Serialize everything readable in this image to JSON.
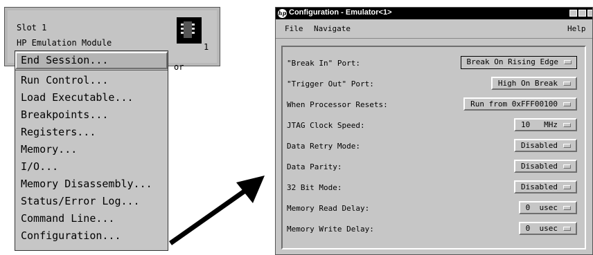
{
  "module_panel": {
    "slot": "Slot 1",
    "name": "HP Emulation Module",
    "chip_number": "1",
    "hidden_tail": "or"
  },
  "popup_menu": {
    "items": [
      "End Session...",
      "Run Control...",
      "Load Executable...",
      "Breakpoints...",
      "Registers...",
      "Memory...",
      "I/O...",
      "Memory Disassembly...",
      "Status/Error Log...",
      "Command Line...",
      "Configuration..."
    ]
  },
  "config_window": {
    "title": "Configuration - Emulator<1>",
    "menu": {
      "file": "File",
      "navigate": "Navigate",
      "help": "Help"
    },
    "settings": [
      {
        "label": "\"Break In\" Port:",
        "value": "Break On Rising Edge"
      },
      {
        "label": "\"Trigger Out\" Port:",
        "value": "High On Break"
      },
      {
        "label": "When Processor Resets:",
        "value": "Run from 0xFFF00100"
      },
      {
        "label": "JTAG Clock Speed:",
        "value": "10   MHz"
      },
      {
        "label": "Data Retry Mode:",
        "value": "Disabled"
      },
      {
        "label": "Data Parity:",
        "value": "Disabled"
      },
      {
        "label": "32 Bit Mode:",
        "value": "Disabled"
      },
      {
        "label": "Memory Read Delay:",
        "value": "0  usec"
      },
      {
        "label": "Memory Write Delay:",
        "value": "0  usec"
      }
    ]
  }
}
